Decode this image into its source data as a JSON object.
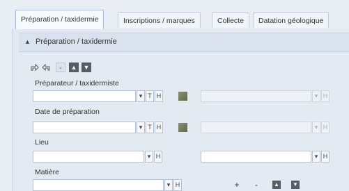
{
  "tabs": [
    {
      "label": "Préparation / taxidermie",
      "active": true
    },
    {
      "label": "Inscriptions / marques"
    },
    {
      "label": "Collecte"
    },
    {
      "label": "Datation géologique"
    }
  ],
  "section": {
    "title": "Préparation / taxidermie",
    "caret_icon": "chevron-up-icon"
  },
  "toolbar": {
    "minus": "-",
    "up": "▲",
    "down": "▼"
  },
  "fields": {
    "preparateur": {
      "label": "Préparateur / taxidermiste",
      "value": "",
      "t": "T",
      "h": "H",
      "h2": "H"
    },
    "date": {
      "label": "Date de préparation",
      "value": "",
      "t": "T",
      "h": "H",
      "h2": "H"
    },
    "lieu": {
      "label": "Lieu",
      "value": "",
      "h": "H",
      "h2": "H"
    },
    "matiere": {
      "label": "Matière",
      "value": "",
      "h": "H",
      "plus": "+",
      "minus": "-",
      "up": "▲",
      "down": "▼"
    }
  },
  "dropdown_glyph": "▾",
  "colors": {
    "background": "#e9eef5",
    "tab_active": "#f7fafd",
    "input": "#ffffff",
    "section_header": "#d9e2ee"
  }
}
